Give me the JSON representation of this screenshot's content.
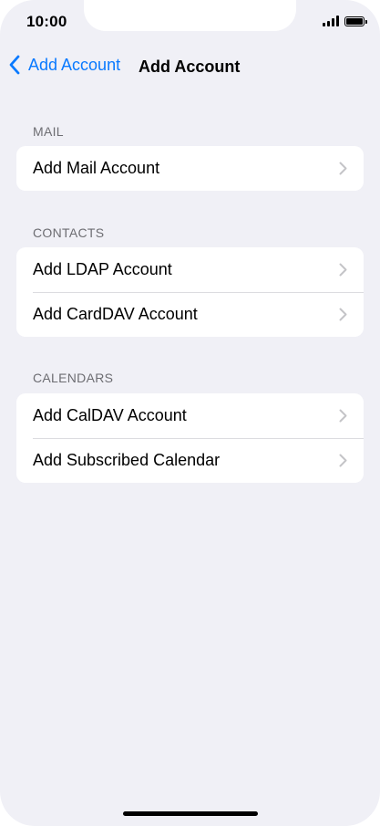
{
  "status_bar": {
    "time": "10:00",
    "signal_icon": "cellular-signal-icon",
    "battery_icon": "battery-full-icon"
  },
  "nav": {
    "back_label": "Add Account",
    "back_icon": "chevron-left-icon",
    "title": "Add Account"
  },
  "colors": {
    "accent": "#0a7aff",
    "background": "#f0f0f6",
    "cell_background": "#ffffff",
    "section_header": "#6d6d72",
    "separator": "#dcdce0",
    "chevron": "#c4c4c7"
  },
  "sections": [
    {
      "header": "MAIL",
      "items": [
        {
          "label": "Add Mail Account"
        }
      ]
    },
    {
      "header": "CONTACTS",
      "items": [
        {
          "label": "Add LDAP Account"
        },
        {
          "label": "Add CardDAV Account"
        }
      ]
    },
    {
      "header": "CALENDARS",
      "items": [
        {
          "label": "Add CalDAV Account"
        },
        {
          "label": "Add Subscribed Calendar"
        }
      ]
    }
  ]
}
